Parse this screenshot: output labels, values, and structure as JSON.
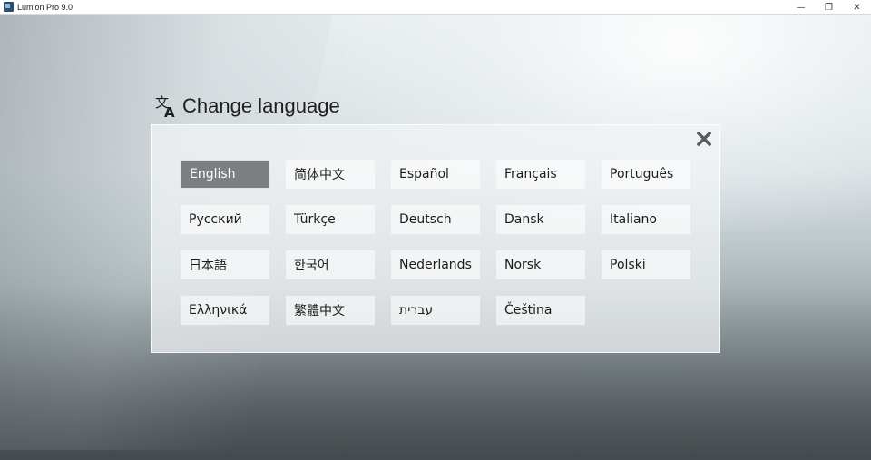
{
  "window": {
    "title": "Lumion Pro 9.0",
    "controls": [
      "—",
      "❐",
      "✕"
    ]
  },
  "dialog": {
    "title": "Change language",
    "close_icon": "close-icon",
    "heading_icon": "translate-icon",
    "selected": "English",
    "languages": [
      "English",
      "简体中文",
      "Español",
      "Français",
      "Português",
      "Русский",
      "Türkçe",
      "Deutsch",
      "Dansk",
      "Italiano",
      "日本語",
      "한국어",
      "Nederlands",
      "Norsk",
      "Polski",
      "Ελληνικά",
      "繁體中文",
      "עברית",
      "Čeština"
    ]
  },
  "colors": {
    "selected_bg": "#7b7f81",
    "button_bg": "#ffffff",
    "panel_bg": "#f1f4f5"
  }
}
